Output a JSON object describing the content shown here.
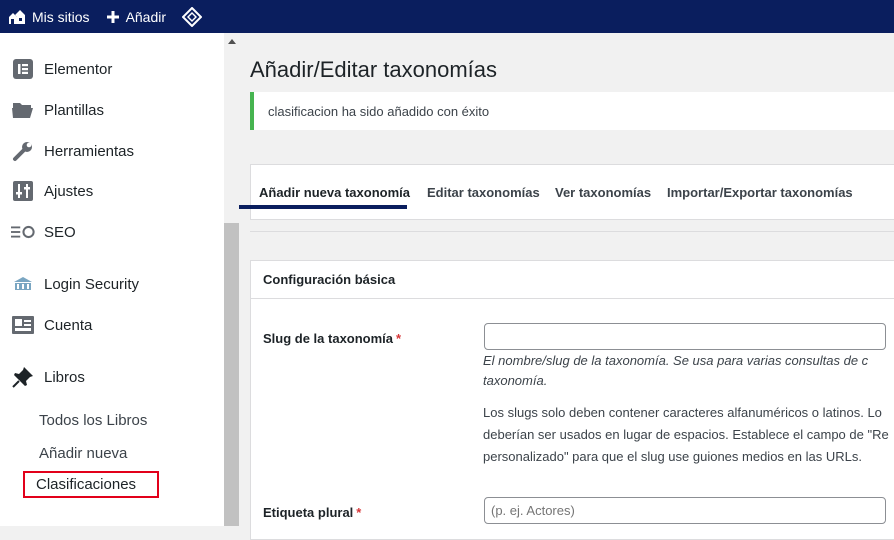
{
  "admin_bar": {
    "my_sites_label": "Mis sitios",
    "new_label": "Añadir"
  },
  "sidebar": {
    "items": [
      {
        "label": "Elementor",
        "icon": "elementor-icon"
      },
      {
        "label": "Plantillas",
        "icon": "folder-icon"
      },
      {
        "label": "Herramientas",
        "icon": "wrench-icon"
      },
      {
        "label": "Ajustes",
        "icon": "settings-sliders-icon"
      },
      {
        "label": "SEO",
        "icon": "seo-icon"
      },
      {
        "label": "Login Security",
        "icon": "login-security-icon"
      },
      {
        "label": "Cuenta",
        "icon": "account-card-icon"
      },
      {
        "label": "Libros",
        "icon": "pushpin-icon"
      }
    ],
    "submenu": [
      {
        "label": "Todos los Libros"
      },
      {
        "label": "Añadir nueva"
      },
      {
        "label": "Clasificaciones"
      }
    ]
  },
  "main": {
    "title": "Añadir/Editar taxonomías",
    "notice": "clasificacion ha sido añadido con éxito",
    "tabs": [
      {
        "label": "Añadir nueva taxonomía",
        "active": true
      },
      {
        "label": "Editar taxonomías"
      },
      {
        "label": "Ver taxonomías"
      },
      {
        "label": "Importar/Exportar taxonomías"
      }
    ],
    "panel": {
      "heading": "Configuración básica",
      "slug": {
        "label": "Slug de la taxonomía",
        "required_mark": "*",
        "value": "",
        "help_line1": "El nombre/slug de la taxonomía. Se usa para varias consultas de c",
        "help_line2": "taxonomía.",
        "note_line1": "Los slugs solo deben contener caracteres alfanuméricos o latinos. Lo",
        "note_line2": "deberían ser usados en lugar de espacios. Establece el campo de \"Re",
        "note_line3": "personalizado\" para que el slug use guiones medios en las URLs."
      },
      "plural": {
        "label": "Etiqueta plural",
        "required_mark": "*",
        "placeholder": "(p. ej. Actores)"
      }
    }
  },
  "colors": {
    "admin_bar": "#0a1e5e",
    "notice_success": "#46b450",
    "highlight_box": "#e2001a",
    "required": "#d63638"
  }
}
